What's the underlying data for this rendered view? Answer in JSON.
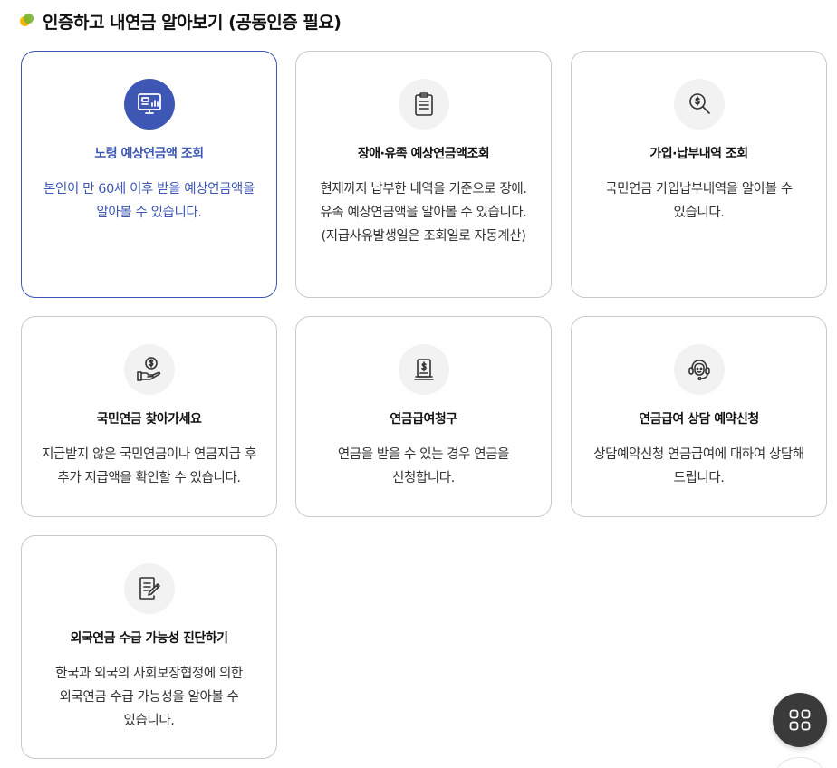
{
  "section": {
    "title": "인증하고 내연금 알아보기 (공동인증 필요)"
  },
  "cards": [
    {
      "title": "노령 예상연금액 조회",
      "desc": "본인이 만 60세 이후 받을 예상연금액을 알아볼 수 있습니다.",
      "icon": "monitor-chart-icon",
      "active": true
    },
    {
      "title": "장애·유족 예상연금액조회",
      "desc": "현재까지 납부한 내역을 기준으로 장애.유족 예상연금액을 알아볼 수 있습니다.(지급사유발생일은 조회일로 자동계산)",
      "icon": "clipboard-icon",
      "active": false
    },
    {
      "title": "가입·납부내역 조회",
      "desc": "국민연금 가입납부내역을 알아볼 수 있습니다.",
      "icon": "magnifier-dollar-icon",
      "active": false
    },
    {
      "title": "국민연금 찾아가세요",
      "desc": "지급받지 않은 국민연금이나 연금지급 후 추가 지급액을 확인할 수 있습니다.",
      "icon": "hand-coin-icon",
      "active": false
    },
    {
      "title": "연금급여청구",
      "desc": "연금을 받을 수 있는 경우 연금을 신청합니다.",
      "icon": "document-dollar-icon",
      "active": false
    },
    {
      "title": "연금급여 상담 예약신청",
      "desc": "상담예약신청 연금급여에 대하여 상담해 드립니다.",
      "icon": "headset-icon",
      "active": false
    },
    {
      "title": "외국연금 수급 가능성 진단하기",
      "desc": "한국과 외국의 사회보장협정에 의한 외국연금 수급 가능성을 알아볼 수 있습니다.",
      "icon": "document-pen-icon",
      "active": false
    }
  ],
  "colors": {
    "accent": "#3f57b4",
    "card_border": "#c9c9c9",
    "icon_bg": "#f2f2f2",
    "fab_bg": "#3a3a3a"
  },
  "fab": {
    "icon": "grid-menu-icon"
  }
}
